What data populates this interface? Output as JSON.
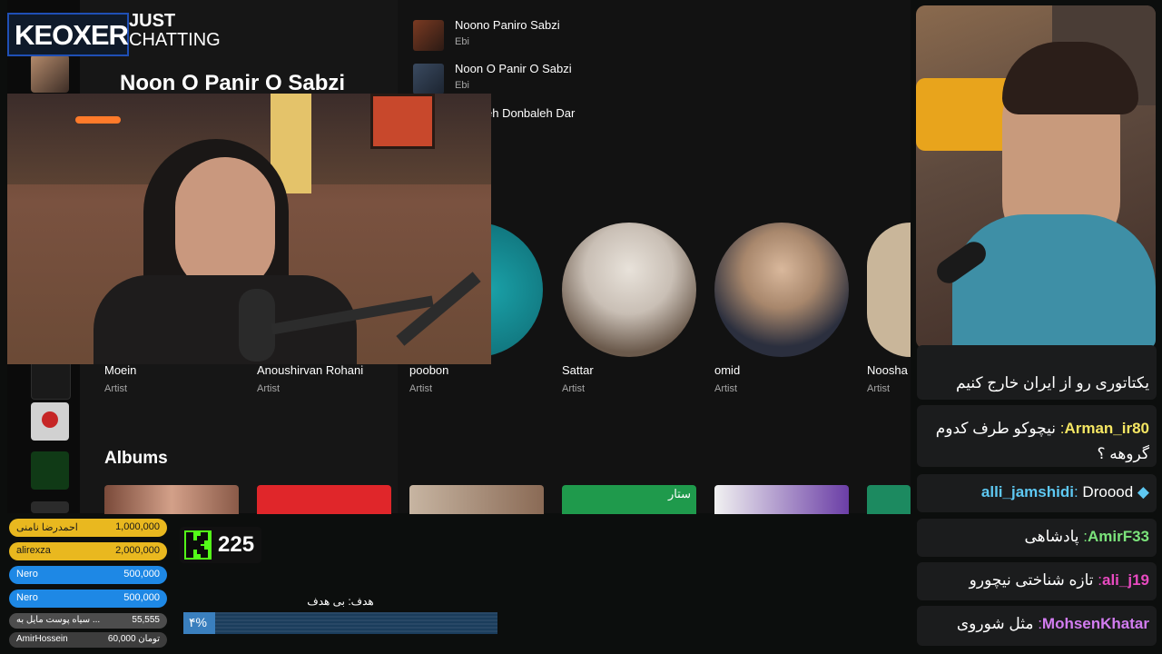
{
  "logo": {
    "text": "KEOXER"
  },
  "category": {
    "line1": "JUST",
    "line2": "CHATTING"
  },
  "player": {
    "title": "Noon O Panir O Sabzi",
    "songs": [
      {
        "title": "Noono Paniro Sabzi",
        "artist": "Ebi"
      },
      {
        "title": "Noon O Panir O Sabzi",
        "artist": "Ebi"
      },
      {
        "title": "eh Donbaleh Dar",
        "artist": ""
      }
    ],
    "artists": [
      {
        "name": "Moein",
        "role": "Artist"
      },
      {
        "name": "Anoushirvan Rohani",
        "role": "Artist"
      },
      {
        "name": "poobon",
        "role": "Artist"
      },
      {
        "name": "Sattar",
        "role": "Artist"
      },
      {
        "name": "omid",
        "role": "Artist"
      },
      {
        "name": "Noosha",
        "role": "Artist"
      }
    ],
    "albums_heading": "Albums",
    "album_label": "ستار"
  },
  "chat": [
    {
      "user": "",
      "text": "یکتاتوری رو از ایران خارج کنیم",
      "color": "#ffffff"
    },
    {
      "user": "Arman_ir80",
      "text": "نیچوکو طرف کدوم گروهه ؟",
      "color": "#f5e663"
    },
    {
      "user": "alli_jamshidi",
      "text": "Droood",
      "color": "#5ec8f2"
    },
    {
      "user": "AmirF33",
      "text": "پادشاهی",
      "color": "#7be37b"
    },
    {
      "user": "ali_j19",
      "text": "تازه شناختی نیچورو",
      "color": "#e84ac0"
    },
    {
      "user": "MohsenKhatar",
      "text": "مثل شوروی",
      "color": "#d27cf0"
    }
  ],
  "donations": [
    {
      "name": "احمدرضا نامنی",
      "amount": "1,000,000",
      "color": "#e9b81f"
    },
    {
      "name": "alirexza",
      "amount": "2,000,000",
      "color": "#e9b81f"
    },
    {
      "name": "Nero",
      "amount": "500,000",
      "color": "#1e88e5"
    },
    {
      "name": "Nero",
      "amount": "500,000",
      "color": "#1e88e5"
    },
    {
      "name": "سیاه پوست مایل به ...",
      "amount": "55,555",
      "color": "#555555"
    },
    {
      "name": "AmirHossein",
      "amount": "60,000 تومان",
      "color": "#444444"
    }
  ],
  "kick": {
    "count": "225"
  },
  "goal": {
    "label": "هدف: بی هدف",
    "percent_text": "۴%",
    "progress": 0.1
  }
}
